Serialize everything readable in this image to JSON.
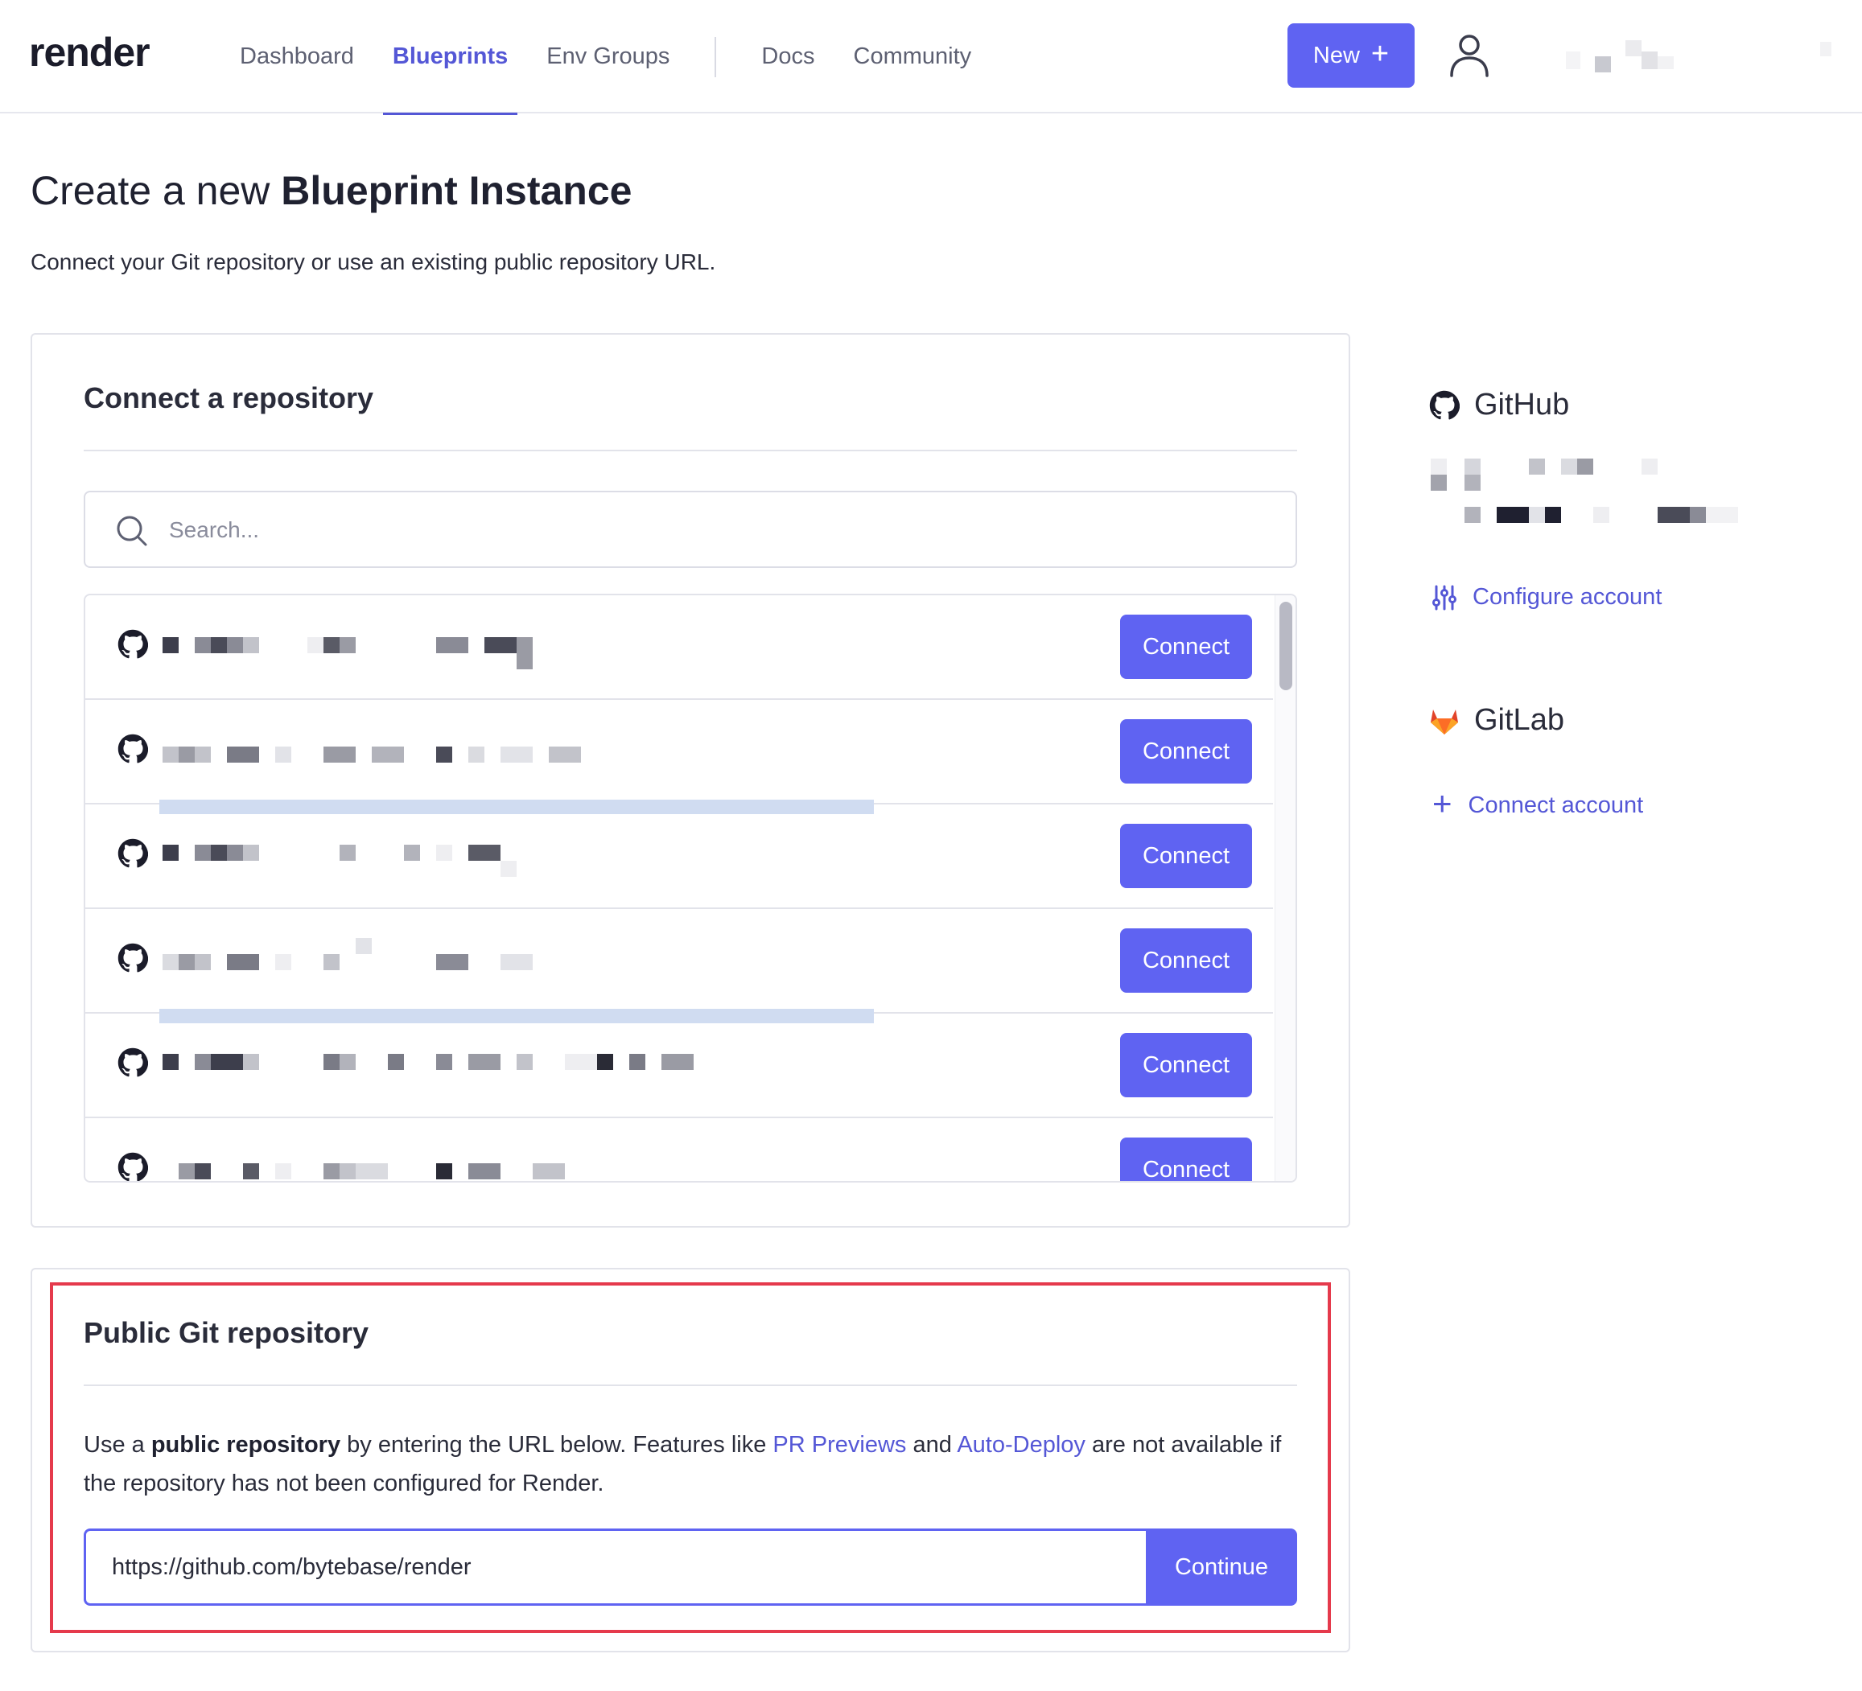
{
  "header": {
    "logo": "render",
    "nav": [
      {
        "label": "Dashboard",
        "active": false
      },
      {
        "label": "Blueprints",
        "active": true
      },
      {
        "label": "Env Groups",
        "active": false
      },
      {
        "label": "Docs",
        "active": false
      },
      {
        "label": "Community",
        "active": false
      }
    ],
    "new_label": "New",
    "accent": "#5f63f2"
  },
  "page": {
    "title_prefix": "Create a new ",
    "title_bold": "Blueprint Instance",
    "subtitle": "Connect your Git repository or use an existing public repository URL."
  },
  "connect": {
    "title": "Connect a repository",
    "search_placeholder": "Search...",
    "connect_label": "Connect",
    "repos": [
      {
        "name": "",
        "icon": "github-icon"
      },
      {
        "name": "",
        "icon": "github-icon"
      },
      {
        "name": "",
        "icon": "github-icon"
      },
      {
        "name": "",
        "icon": "github-icon"
      },
      {
        "name": "",
        "icon": "github-icon"
      },
      {
        "name": "",
        "icon": "github-icon"
      }
    ]
  },
  "public": {
    "title": "Public Git repository",
    "text_1": "Use a ",
    "text_bold": "public repository",
    "text_2": " by entering the URL below. Features like ",
    "link_pr": "PR Previews",
    "text_3": " and ",
    "link_auto": "Auto-Deploy",
    "text_4": " are not available if the repository has not been configured for Render.",
    "url_value": "https://github.com/bytebase/render",
    "continue_label": "Continue",
    "highlight_color": "#e53a4c"
  },
  "side": {
    "github_title": "GitHub",
    "configure_label": "Configure account",
    "gitlab_title": "GitLab",
    "connect_account_label": "Connect account"
  }
}
